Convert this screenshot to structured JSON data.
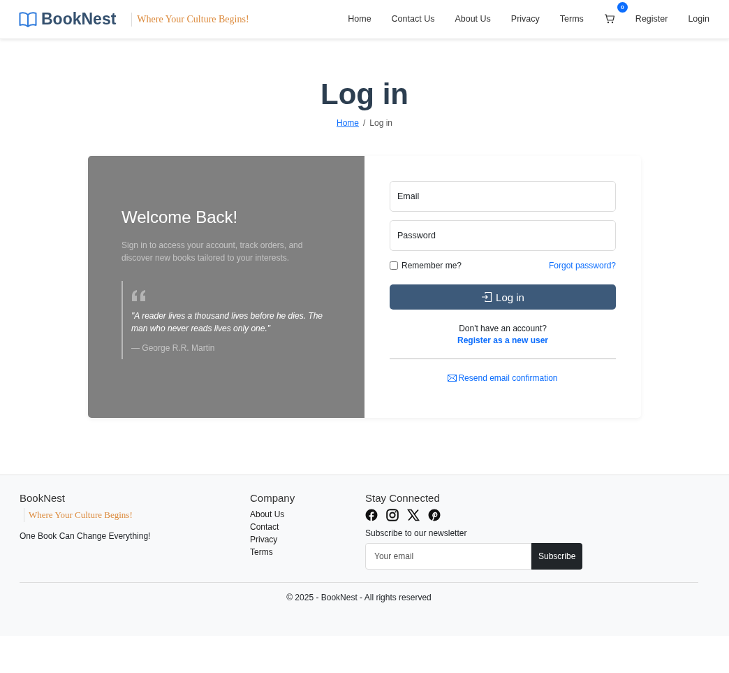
{
  "brand": {
    "name": "BookNest",
    "tagline": "Where Your Culture Begins!"
  },
  "nav": [
    {
      "label": "Home",
      "kind": "link"
    },
    {
      "label": "Contact Us",
      "kind": "link"
    },
    {
      "label": "About Us",
      "kind": "link"
    },
    {
      "label": "Privacy",
      "kind": "link"
    },
    {
      "label": "Terms",
      "kind": "link"
    },
    {
      "kind": "cart",
      "badge": "0"
    },
    {
      "label": "Register",
      "kind": "link"
    },
    {
      "label": "Login",
      "kind": "link"
    }
  ],
  "page": {
    "title": "Log in",
    "breadcrumb_separator": "/",
    "breadcrumb": [
      {
        "label": "Home",
        "link": true
      },
      {
        "label": "Log in",
        "link": false
      }
    ]
  },
  "welcome": {
    "title": "Welcome Back!",
    "text": "Sign in to access your account, track orders, and discover new books tailored to your interests.",
    "quote": "\"A reader lives a thousand lives before he dies. The man who never reads lives only one.\"",
    "author": "— George R.R. Martin"
  },
  "form": {
    "fields": [
      {
        "placeholder": "Email"
      },
      {
        "placeholder": "Password"
      }
    ],
    "remember": {
      "label": "Remember me?",
      "checked": false
    },
    "forgot": "Forgot password?",
    "submit": "Log in",
    "no_account": "Don't have an account?",
    "register": "Register as a new user",
    "resend": "Resend email confirmation"
  },
  "footer": {
    "brand": "BookNest",
    "tagline": "Where Your Culture Begins!",
    "slogan": "One Book Can Change Everything!",
    "company_title": "Company",
    "company_links": [
      "About Us",
      "Contact",
      "Privacy",
      "Terms"
    ],
    "social_title": "Stay Connected",
    "social": [
      {
        "kind": "facebook"
      },
      {
        "kind": "instagram"
      },
      {
        "kind": "x"
      },
      {
        "kind": "pinterest"
      }
    ],
    "newsletter_label": "Subscribe to our newsletter",
    "email_placeholder": "Your email",
    "subscribe": "Subscribe",
    "copyright": "© 2025 - BookNest - All rights reserved"
  }
}
